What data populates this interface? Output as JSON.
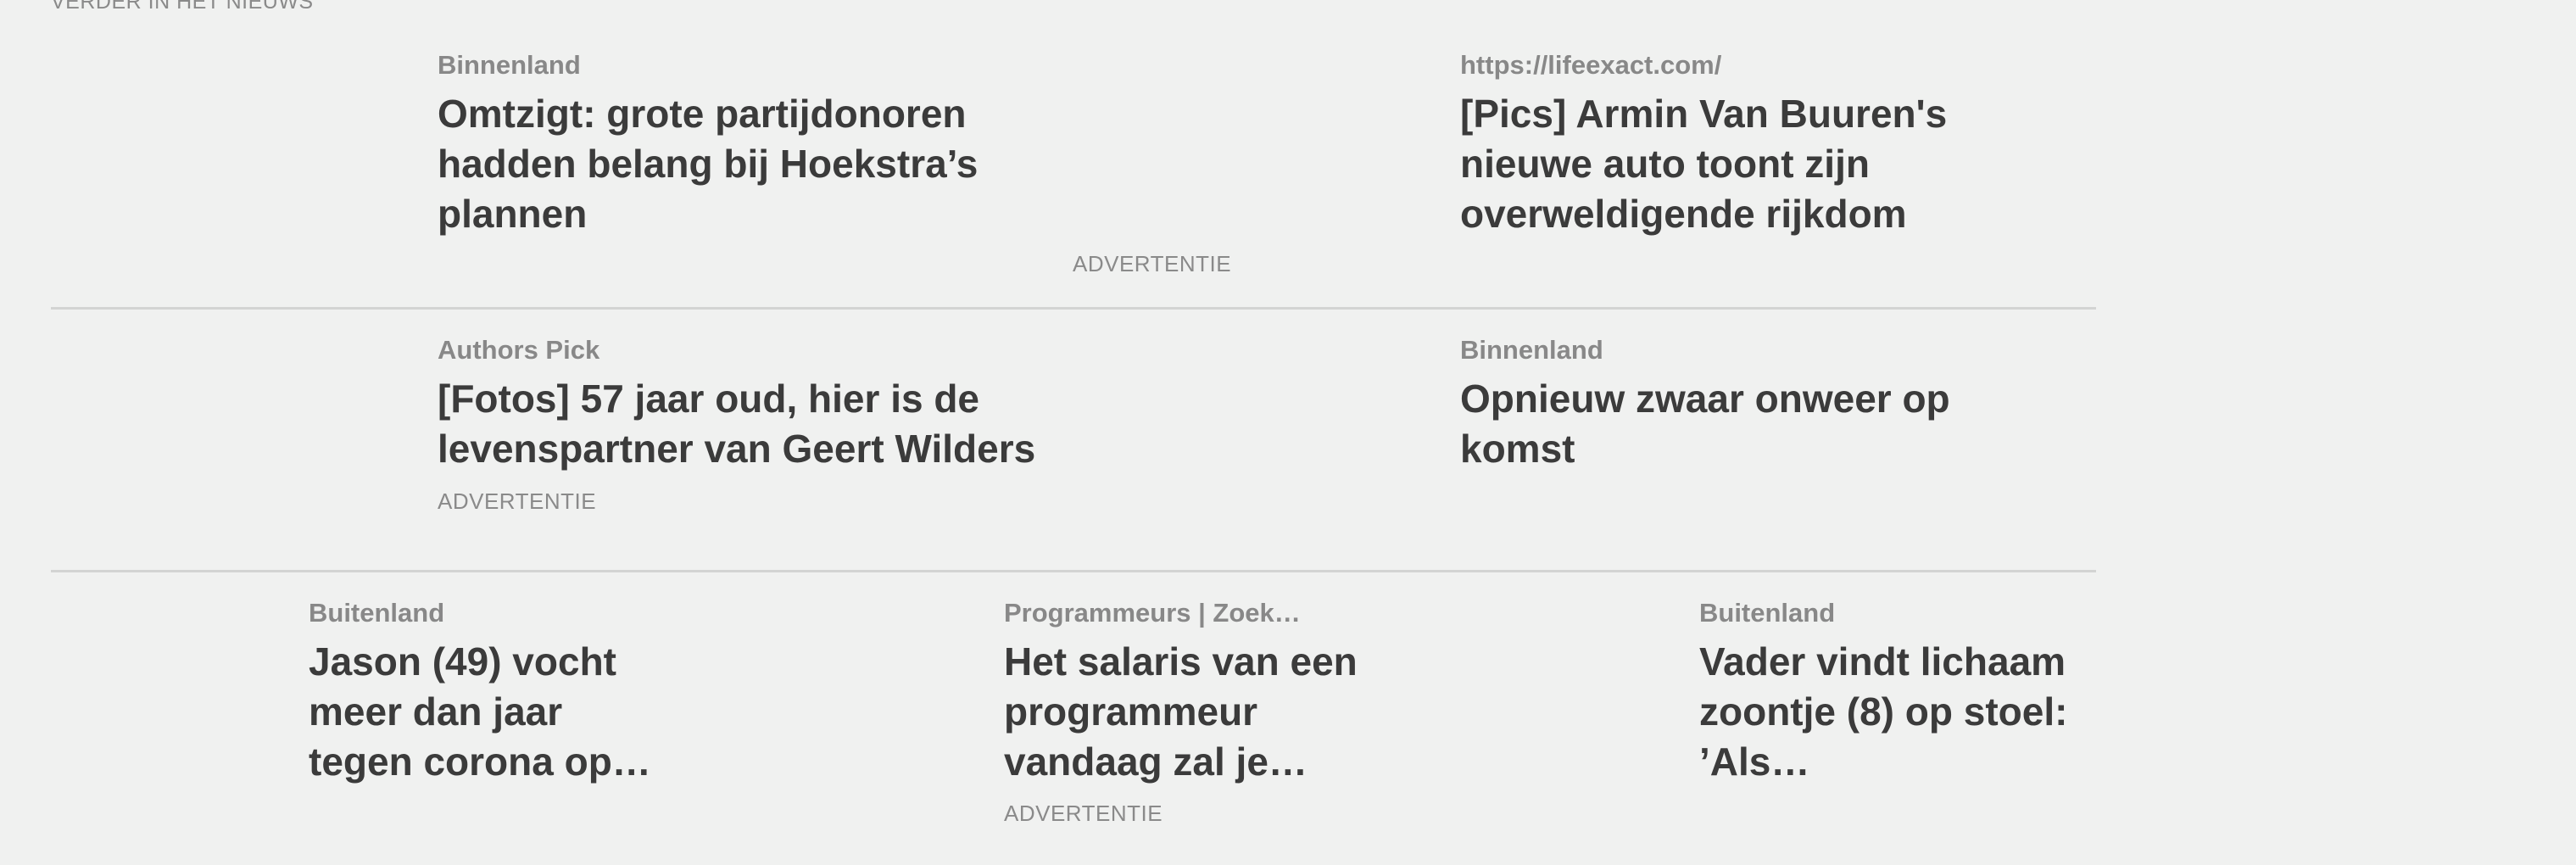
{
  "section": {
    "label": "VERDER IN HET NIEUWS"
  },
  "ad_label": "ADVERTENTIE",
  "rows": [
    {
      "cards": [
        {
          "category": "Binnenland",
          "headline": "Omtzigt: grote partijdonoren hadden belang bij Hoekstra’s plannen"
        },
        {
          "category": "https://lifeexact.com/",
          "headline": "[Pics] Armin Van Buuren's nieuwe auto toont zijn overweldigende rijkdom"
        }
      ]
    },
    {
      "cards": [
        {
          "category": "Authors Pick",
          "headline": "[Fotos] 57 jaar oud, hier is de levenspartner van Geert Wilders"
        },
        {
          "category": "Binnenland",
          "headline": "Opnieuw zwaar onweer op komst"
        }
      ]
    },
    {
      "cards": [
        {
          "category": "Buitenland",
          "headline": "Jason (49) vocht meer dan jaar tegen corona op…"
        },
        {
          "category": "Programmeurs | Zoek…",
          "headline": "Het salaris van een programmeur vandaag zal je…"
        },
        {
          "category": "Buitenland",
          "headline": "Vader vindt lichaam zoontje (8) op stoel: ’Als…"
        }
      ]
    }
  ]
}
